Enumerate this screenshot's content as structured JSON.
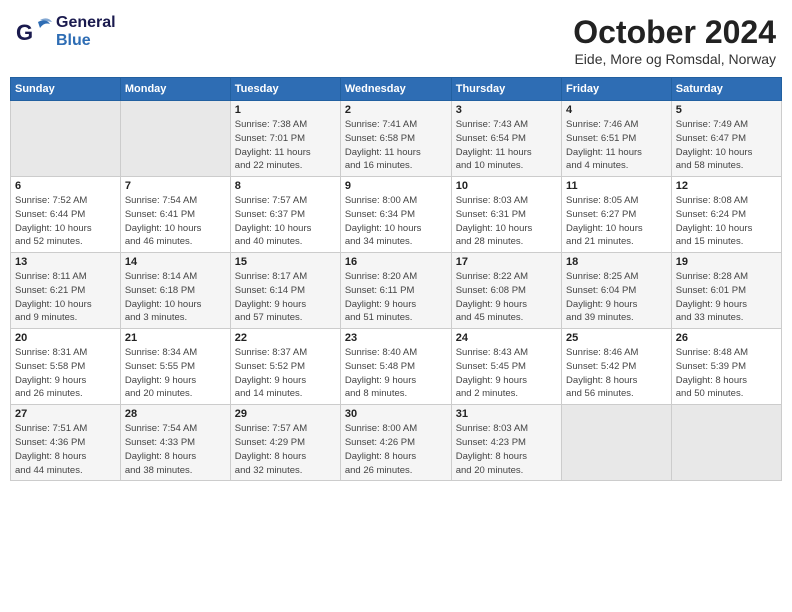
{
  "header": {
    "logo_line1": "General",
    "logo_line2": "Blue",
    "month": "October 2024",
    "location": "Eide, More og Romsdal, Norway"
  },
  "weekdays": [
    "Sunday",
    "Monday",
    "Tuesday",
    "Wednesday",
    "Thursday",
    "Friday",
    "Saturday"
  ],
  "weeks": [
    [
      {
        "day": "",
        "info": ""
      },
      {
        "day": "",
        "info": ""
      },
      {
        "day": "1",
        "info": "Sunrise: 7:38 AM\nSunset: 7:01 PM\nDaylight: 11 hours\nand 22 minutes."
      },
      {
        "day": "2",
        "info": "Sunrise: 7:41 AM\nSunset: 6:58 PM\nDaylight: 11 hours\nand 16 minutes."
      },
      {
        "day": "3",
        "info": "Sunrise: 7:43 AM\nSunset: 6:54 PM\nDaylight: 11 hours\nand 10 minutes."
      },
      {
        "day": "4",
        "info": "Sunrise: 7:46 AM\nSunset: 6:51 PM\nDaylight: 11 hours\nand 4 minutes."
      },
      {
        "day": "5",
        "info": "Sunrise: 7:49 AM\nSunset: 6:47 PM\nDaylight: 10 hours\nand 58 minutes."
      }
    ],
    [
      {
        "day": "6",
        "info": "Sunrise: 7:52 AM\nSunset: 6:44 PM\nDaylight: 10 hours\nand 52 minutes."
      },
      {
        "day": "7",
        "info": "Sunrise: 7:54 AM\nSunset: 6:41 PM\nDaylight: 10 hours\nand 46 minutes."
      },
      {
        "day": "8",
        "info": "Sunrise: 7:57 AM\nSunset: 6:37 PM\nDaylight: 10 hours\nand 40 minutes."
      },
      {
        "day": "9",
        "info": "Sunrise: 8:00 AM\nSunset: 6:34 PM\nDaylight: 10 hours\nand 34 minutes."
      },
      {
        "day": "10",
        "info": "Sunrise: 8:03 AM\nSunset: 6:31 PM\nDaylight: 10 hours\nand 28 minutes."
      },
      {
        "day": "11",
        "info": "Sunrise: 8:05 AM\nSunset: 6:27 PM\nDaylight: 10 hours\nand 21 minutes."
      },
      {
        "day": "12",
        "info": "Sunrise: 8:08 AM\nSunset: 6:24 PM\nDaylight: 10 hours\nand 15 minutes."
      }
    ],
    [
      {
        "day": "13",
        "info": "Sunrise: 8:11 AM\nSunset: 6:21 PM\nDaylight: 10 hours\nand 9 minutes."
      },
      {
        "day": "14",
        "info": "Sunrise: 8:14 AM\nSunset: 6:18 PM\nDaylight: 10 hours\nand 3 minutes."
      },
      {
        "day": "15",
        "info": "Sunrise: 8:17 AM\nSunset: 6:14 PM\nDaylight: 9 hours\nand 57 minutes."
      },
      {
        "day": "16",
        "info": "Sunrise: 8:20 AM\nSunset: 6:11 PM\nDaylight: 9 hours\nand 51 minutes."
      },
      {
        "day": "17",
        "info": "Sunrise: 8:22 AM\nSunset: 6:08 PM\nDaylight: 9 hours\nand 45 minutes."
      },
      {
        "day": "18",
        "info": "Sunrise: 8:25 AM\nSunset: 6:04 PM\nDaylight: 9 hours\nand 39 minutes."
      },
      {
        "day": "19",
        "info": "Sunrise: 8:28 AM\nSunset: 6:01 PM\nDaylight: 9 hours\nand 33 minutes."
      }
    ],
    [
      {
        "day": "20",
        "info": "Sunrise: 8:31 AM\nSunset: 5:58 PM\nDaylight: 9 hours\nand 26 minutes."
      },
      {
        "day": "21",
        "info": "Sunrise: 8:34 AM\nSunset: 5:55 PM\nDaylight: 9 hours\nand 20 minutes."
      },
      {
        "day": "22",
        "info": "Sunrise: 8:37 AM\nSunset: 5:52 PM\nDaylight: 9 hours\nand 14 minutes."
      },
      {
        "day": "23",
        "info": "Sunrise: 8:40 AM\nSunset: 5:48 PM\nDaylight: 9 hours\nand 8 minutes."
      },
      {
        "day": "24",
        "info": "Sunrise: 8:43 AM\nSunset: 5:45 PM\nDaylight: 9 hours\nand 2 minutes."
      },
      {
        "day": "25",
        "info": "Sunrise: 8:46 AM\nSunset: 5:42 PM\nDaylight: 8 hours\nand 56 minutes."
      },
      {
        "day": "26",
        "info": "Sunrise: 8:48 AM\nSunset: 5:39 PM\nDaylight: 8 hours\nand 50 minutes."
      }
    ],
    [
      {
        "day": "27",
        "info": "Sunrise: 7:51 AM\nSunset: 4:36 PM\nDaylight: 8 hours\nand 44 minutes."
      },
      {
        "day": "28",
        "info": "Sunrise: 7:54 AM\nSunset: 4:33 PM\nDaylight: 8 hours\nand 38 minutes."
      },
      {
        "day": "29",
        "info": "Sunrise: 7:57 AM\nSunset: 4:29 PM\nDaylight: 8 hours\nand 32 minutes."
      },
      {
        "day": "30",
        "info": "Sunrise: 8:00 AM\nSunset: 4:26 PM\nDaylight: 8 hours\nand 26 minutes."
      },
      {
        "day": "31",
        "info": "Sunrise: 8:03 AM\nSunset: 4:23 PM\nDaylight: 8 hours\nand 20 minutes."
      },
      {
        "day": "",
        "info": ""
      },
      {
        "day": "",
        "info": ""
      }
    ]
  ]
}
